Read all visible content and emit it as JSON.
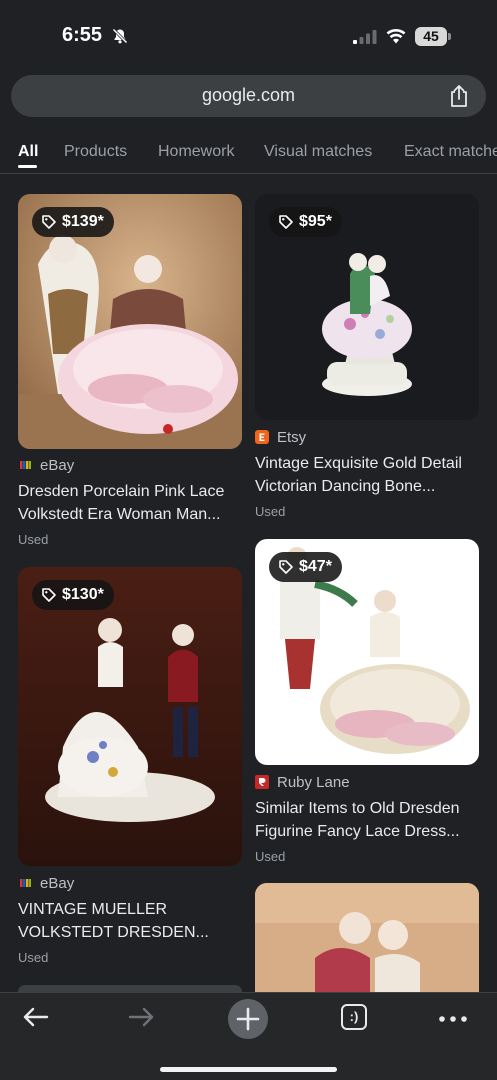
{
  "status_bar": {
    "time": "6:55",
    "battery": "45"
  },
  "browser": {
    "url": "google.com"
  },
  "tabs": [
    {
      "label": "All",
      "active": true
    },
    {
      "label": "Products",
      "active": false
    },
    {
      "label": "Homework",
      "active": false
    },
    {
      "label": "Visual matches",
      "active": false
    },
    {
      "label": "Exact matches",
      "active": false
    }
  ],
  "results": [
    {
      "price": "$139*",
      "source": "eBay",
      "title_line1": "Dresden Porcelain Pink Lace",
      "title_line2": "Volkstedt Era Woman Man...",
      "condition": "Used"
    },
    {
      "price": "$95*",
      "source": "Etsy",
      "title_line1": "Vintage Exquisite Gold Detail",
      "title_line2": "Victorian Dancing Bone...",
      "condition": "Used"
    },
    {
      "price": "$130*",
      "source": "eBay",
      "title_line1": "VINTAGE MUELLER",
      "title_line2": "VOLKSTEDT DRESDEN...",
      "condition": "Used"
    },
    {
      "price": "$47*",
      "source": "Ruby Lane",
      "title_line1": "Similar Items to Old Dresden",
      "title_line2": "Figurine Fancy Lace Dress...",
      "condition": "Used"
    },
    {
      "price": "",
      "source": "",
      "title_line1": "",
      "title_line2": "",
      "condition": ""
    }
  ],
  "toolbar": {
    "tab_count": ":)"
  },
  "colors": {
    "background": "#202124",
    "card_surface": "#3c4043",
    "etsy": "#f1641e",
    "ruby_lane": "#c62828"
  },
  "icons": [
    "bell-off-icon",
    "signal-icon",
    "wifi-icon",
    "battery-icon",
    "share-icon",
    "price-tag-icon",
    "ebay-icon",
    "etsy-icon",
    "ruby-lane-icon",
    "back-arrow-icon",
    "forward-arrow-icon",
    "plus-icon",
    "tab-switcher-icon",
    "more-dots-icon"
  ]
}
